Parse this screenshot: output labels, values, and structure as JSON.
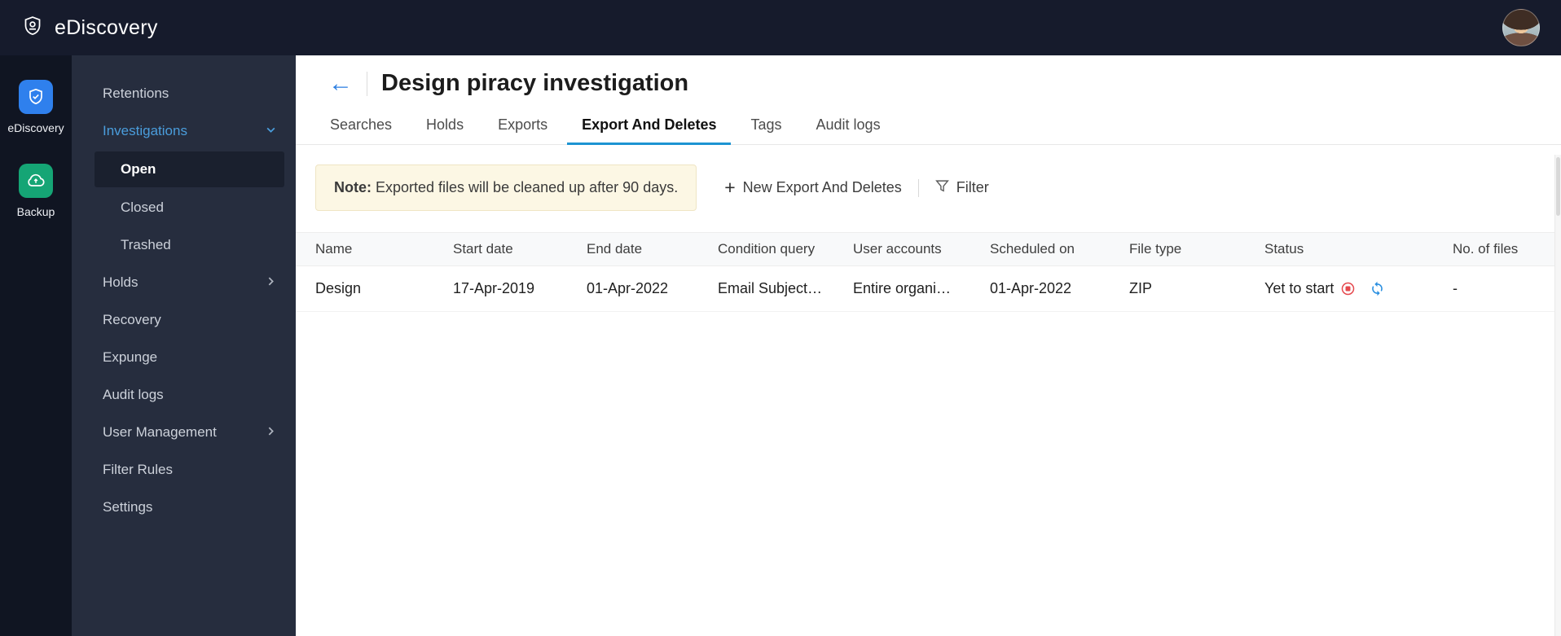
{
  "topbar": {
    "app_name": "eDiscovery"
  },
  "rail": {
    "ediscovery_label": "eDiscovery",
    "backup_label": "Backup"
  },
  "sidebar": {
    "items": [
      {
        "label": "Retentions"
      },
      {
        "label": "Investigations"
      },
      {
        "label": "Open"
      },
      {
        "label": "Closed"
      },
      {
        "label": "Trashed"
      },
      {
        "label": "Holds"
      },
      {
        "label": "Recovery"
      },
      {
        "label": "Expunge"
      },
      {
        "label": "Audit logs"
      },
      {
        "label": "User Management"
      },
      {
        "label": "Filter Rules"
      },
      {
        "label": "Settings"
      }
    ]
  },
  "header": {
    "title": "Design piracy investigation"
  },
  "tabs": [
    {
      "label": "Searches"
    },
    {
      "label": "Holds"
    },
    {
      "label": "Exports"
    },
    {
      "label": "Export And Deletes",
      "active": true
    },
    {
      "label": "Tags"
    },
    {
      "label": "Audit logs"
    }
  ],
  "note": {
    "label": "Note:",
    "text": " Exported files will be cleaned up after 90 days."
  },
  "actions": {
    "new_export_label": "New Export And Deletes",
    "filter_label": "Filter"
  },
  "icons": {
    "plus": "+",
    "back": "←"
  },
  "table": {
    "columns": [
      "Name",
      "Start date",
      "End date",
      "Condition query",
      "User accounts",
      "Scheduled on",
      "File type",
      "Status",
      "No. of files"
    ],
    "rows": [
      {
        "name": "Design",
        "start_date": "17-Apr-2019",
        "end_date": "01-Apr-2022",
        "condition_query": "Email Subject…",
        "user_accounts": "Entire organi…",
        "scheduled_on": "01-Apr-2022",
        "file_type": "ZIP",
        "status": "Yet to start",
        "no_of_files": "-"
      }
    ]
  },
  "colors": {
    "topbar_bg": "#161b2c",
    "sidebar_bg": "#262d3e",
    "accent_blue": "#1d94d2",
    "investigations_blue": "#4a9ddc",
    "status_stop_red": "#e5484d",
    "refresh_blue": "#2a8fe0",
    "note_bg": "#fcf7e4"
  }
}
